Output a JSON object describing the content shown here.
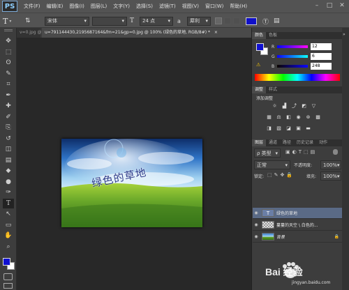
{
  "app": {
    "logo": "PS"
  },
  "menu": [
    "文件(F)",
    "编辑(E)",
    "图像(I)",
    "图层(L)",
    "文字(Y)",
    "选择(S)",
    "滤镜(T)",
    "视图(V)",
    "窗口(W)",
    "帮助(H)"
  ],
  "window_buttons": [
    "–",
    "□",
    "✕"
  ],
  "options_bar": {
    "tool_glyph": "T",
    "font_family": "宋体",
    "font_size_icon": "T",
    "font_size": "24 点",
    "aa_icon": "a",
    "antialias": "犀利",
    "text_color": "#1010c8"
  },
  "tabs": {
    "left_partial": "v=0.jpg @",
    "active": "u=791144430,2195687164&fm=21&gp=0.jpg @ 100% (绿色的草地, RGB/8#) *",
    "close": "×"
  },
  "tools": [
    "move-tool",
    "marquee-tool",
    "lasso-tool",
    "quick-select-tool",
    "crop-tool",
    "eyedropper-tool",
    "healing-tool",
    "brush-tool",
    "stamp-tool",
    "history-brush-tool",
    "eraser-tool",
    "gradient-tool",
    "blur-tool",
    "dodge-tool",
    "pen-tool",
    "type-tool",
    "path-select-tool",
    "shape-tool",
    "hand-tool",
    "zoom-tool"
  ],
  "tool_glyphs": [
    "✥",
    "⬚",
    "ʘ",
    "✎",
    "⌗",
    "✒",
    "✚",
    "✐",
    "⎘",
    "↺",
    "◫",
    "▤",
    "◆",
    "●",
    "✑",
    "T",
    "↖",
    "▭",
    "✋",
    "⌕"
  ],
  "colors": {
    "foreground": "#1010d0",
    "background": "#ffffff"
  },
  "canvas": {
    "text": "绿色的草地"
  },
  "color_panel": {
    "tabs": [
      "颜色",
      "色板"
    ],
    "r_label": "R",
    "r_value": "12",
    "g_label": "G",
    "g_value": "6",
    "b_label": "B",
    "b_value": "248"
  },
  "adjust_panel": {
    "tabs": [
      "调整",
      "样式"
    ],
    "title": "添加调整"
  },
  "layers_panel": {
    "tabs": [
      "图层",
      "通道",
      "路径",
      "历史记录",
      "动作"
    ],
    "kind_label": "ρ 类型",
    "blend_mode": "正常",
    "opacity_label": "不透明度:",
    "opacity_value": "100%",
    "lock_label": "锁定:",
    "fill_label": "填充:",
    "fill_value": "100%",
    "layers": [
      {
        "name": "绿色的草地",
        "type": "text"
      },
      {
        "name": "蔓蔓的天空 \\ 白色的...",
        "type": "image"
      },
      {
        "name": "背景",
        "type": "background"
      }
    ]
  },
  "watermark": {
    "text": "Bai 经验",
    "url": "jingyan.baidu.com"
  }
}
